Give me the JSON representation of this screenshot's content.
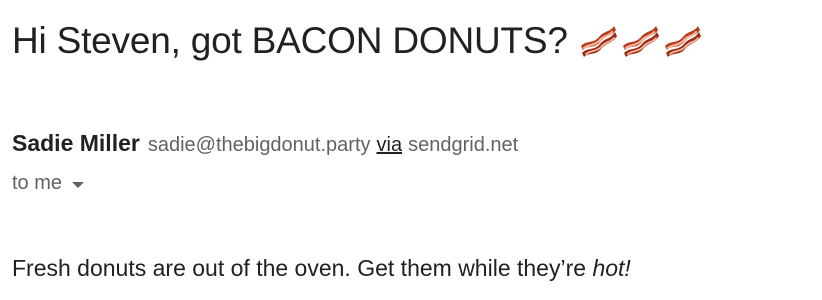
{
  "email": {
    "subject": "Hi Steven, got BACON DONUTS?",
    "subject_icons": [
      "bacon-icon",
      "bacon-icon",
      "bacon-icon"
    ],
    "sender": {
      "name": "Sadie Miller",
      "email": "sadie@thebigdonut.party",
      "via_label": "via",
      "via_domain": "sendgrid.net"
    },
    "recipient_label": "to me",
    "body": {
      "text": "Fresh donuts are out of the oven. Get them while they’re ",
      "emphasis": "hot!"
    }
  },
  "colors": {
    "text_primary": "#202124",
    "text_secondary": "#5f6368",
    "bacon_dark": "#9b2a12",
    "bacon_light": "#f3b69a"
  }
}
